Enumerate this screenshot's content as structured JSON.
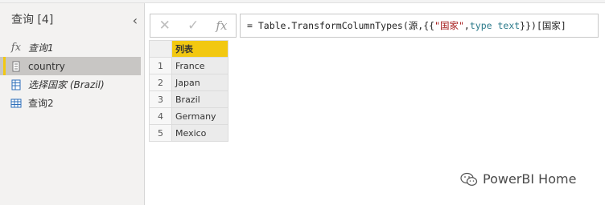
{
  "query_pane": {
    "title": "查询 [4]",
    "items": [
      {
        "label": "查询1",
        "icon": "fx-icon",
        "italic": true
      },
      {
        "label": "country",
        "icon": "list-icon",
        "italic": false,
        "selected": true
      },
      {
        "label": "选择国家 (Brazil)",
        "icon": "record-icon",
        "italic": true
      },
      {
        "label": "查询2",
        "icon": "table-icon",
        "italic": false
      }
    ]
  },
  "formula_bar": {
    "cancel_glyph": "✕",
    "commit_glyph": "✓",
    "fx_glyph": "fx",
    "prefix": "= Table.TransformColumnTypes(源,{{",
    "string_token": "\"国家\"",
    "separator": ", ",
    "keyword_token": "type text",
    "suffix": "}})[国家]"
  },
  "grid": {
    "column_header": "列表",
    "rows": [
      {
        "num": "1",
        "value": "France"
      },
      {
        "num": "2",
        "value": "Japan"
      },
      {
        "num": "3",
        "value": "Brazil"
      },
      {
        "num": "4",
        "value": "Germany"
      },
      {
        "num": "5",
        "value": "Mexico"
      }
    ]
  },
  "watermark": {
    "text": "PowerBI Home"
  },
  "colors": {
    "accent": "#f2c811",
    "selected_bg": "#c8c6c4"
  }
}
